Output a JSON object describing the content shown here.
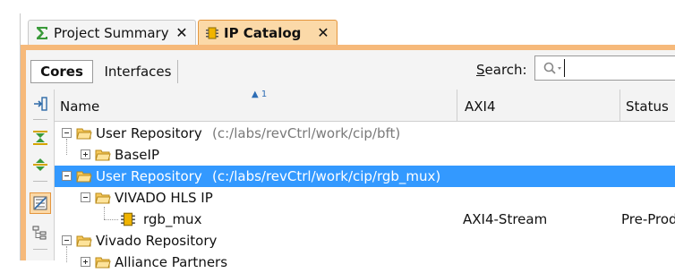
{
  "tabs": [
    {
      "label": "Project Summary",
      "icon": "sigma-icon",
      "active": false
    },
    {
      "label": "IP Catalog",
      "icon": "ip-chip-icon",
      "active": true
    }
  ],
  "close_glyph": "✕",
  "view_tabs": {
    "cores": "Cores",
    "interfaces": "Interfaces"
  },
  "search": {
    "label_prefix": "S",
    "label_rest": "earch:",
    "value": ""
  },
  "columns": {
    "name": "Name",
    "sort_indicator": "▲ 1",
    "axi4": "AXI4",
    "status": "Status"
  },
  "tree_rows": [
    {
      "label": "User Repository",
      "path": "(c:/labs/revCtrl/work/cip/bft)",
      "axi4": "",
      "status": "",
      "expanded": true,
      "selected": false
    },
    {
      "label": "BaseIP",
      "path": "",
      "axi4": "",
      "status": "",
      "expanded": false,
      "selected": false
    },
    {
      "label": "User Repository",
      "path": "(c:/labs/revCtrl/work/cip/rgb_mux)",
      "axi4": "",
      "status": "",
      "expanded": true,
      "selected": true
    },
    {
      "label": "VIVADO HLS IP",
      "path": "",
      "axi4": "",
      "status": "",
      "expanded": true,
      "selected": false
    },
    {
      "label": "rgb_mux",
      "path": "",
      "axi4": "AXI4-Stream",
      "status": "Pre-Prod",
      "expanded": false,
      "selected": false
    },
    {
      "label": "Vivado Repository",
      "path": "",
      "axi4": "",
      "status": "",
      "expanded": true,
      "selected": false
    },
    {
      "label": "Alliance Partners",
      "path": "",
      "axi4": "",
      "status": "",
      "expanded": false,
      "selected": false
    }
  ],
  "colors": {
    "accent_orange": "#f6b97a",
    "selection_blue": "#3399ff",
    "folder_yellow": "#f7c95c"
  }
}
